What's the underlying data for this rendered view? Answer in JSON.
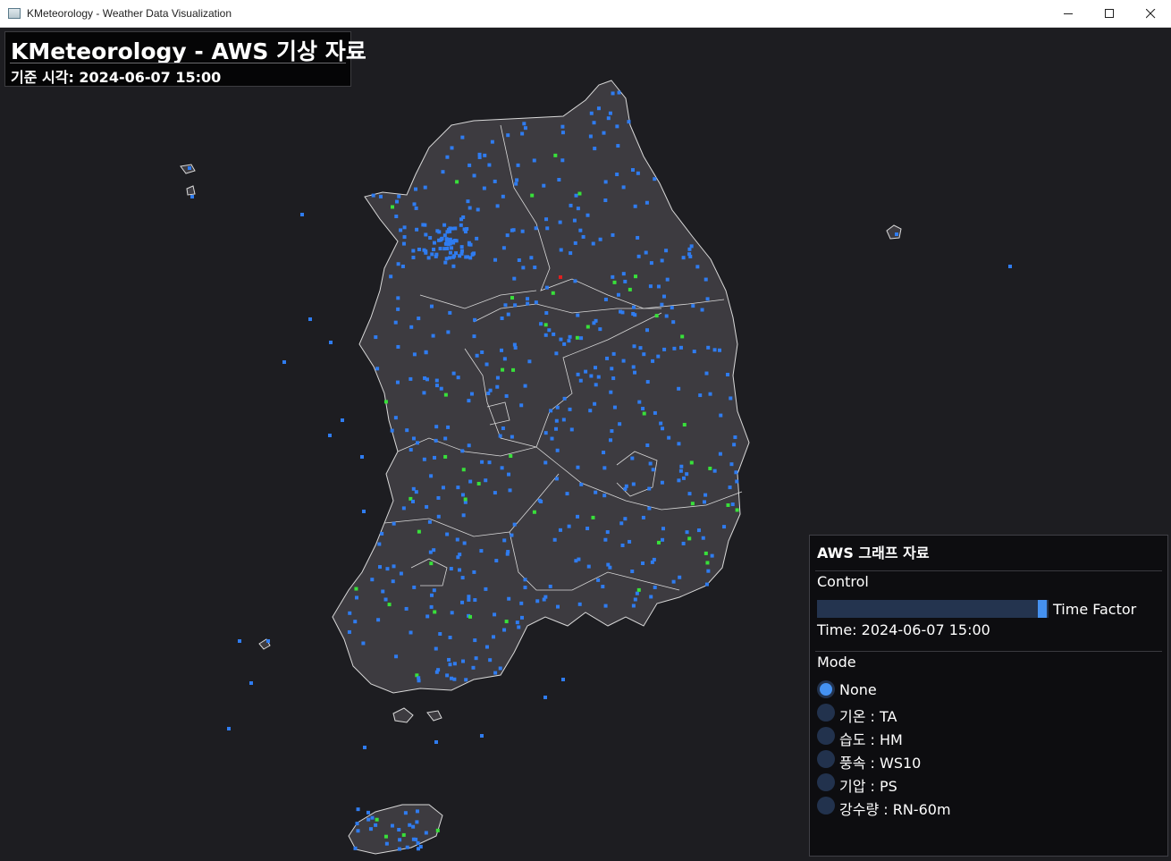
{
  "window": {
    "title": "KMeteorology - Weather Data Visualization",
    "controls": [
      "minimize-icon",
      "maximize-icon",
      "close-icon"
    ]
  },
  "header": {
    "title": "KMeteorology - AWS 기상 자료",
    "reference_time": "기준 시각: 2024-06-07 15:00"
  },
  "map": {
    "land_color": "#3d3b40",
    "border_color": "#d9d9d9",
    "station_colors": {
      "normal": "#2f7cf0",
      "highlight": "#38e03a",
      "alert": "#e02020"
    }
  },
  "panel": {
    "title": "AWS 그래프 자료",
    "control_label": "Control",
    "slider": {
      "label": "Time Factor",
      "value_fraction": 1.0
    },
    "time_readout": "Time: 2024-06-07 15:00",
    "mode_label": "Mode",
    "modes": [
      {
        "label": "None",
        "selected": true
      },
      {
        "label": "기온 : TA",
        "selected": false
      },
      {
        "label": "습도 : HM",
        "selected": false
      },
      {
        "label": "풍속 : WS10",
        "selected": false
      },
      {
        "label": "기압 : PS",
        "selected": false
      },
      {
        "label": "강수량 : RN-60m",
        "selected": false
      }
    ]
  }
}
